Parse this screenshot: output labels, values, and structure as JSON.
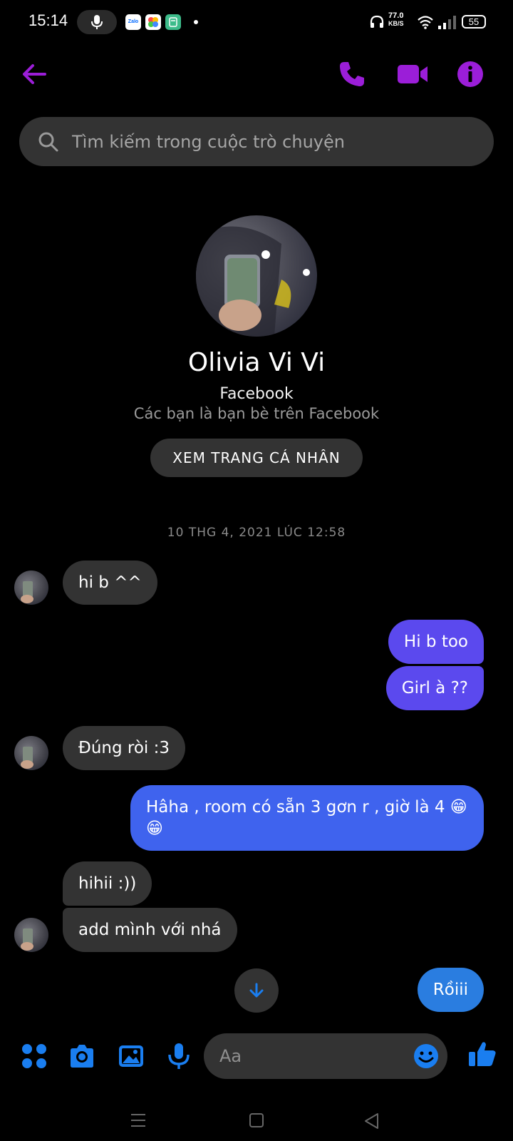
{
  "status_bar": {
    "time": "15:14",
    "apps": [
      "Zalo",
      "",
      ""
    ],
    "speed_value": "77.0",
    "speed_unit": "KB/S",
    "battery": "55"
  },
  "header": {
    "back_icon": "arrow-left-icon",
    "call_icon": "phone-icon",
    "video_icon": "video-camera-icon",
    "info_icon": "info-icon",
    "accent_color": "#9b1ed8"
  },
  "search": {
    "placeholder": "Tìm kiếm trong cuộc trò chuyện"
  },
  "profile": {
    "name": "Olivia Vi Vi",
    "platform": "Facebook",
    "relation": "Các bạn là bạn bè trên Facebook",
    "view_profile_label": "XEM TRANG CÁ NHÂN"
  },
  "conversation": {
    "timestamp": "10 THG 4, 2021 LÚC 12:58",
    "messages": [
      {
        "from": "them",
        "text": "hi b ^^"
      },
      {
        "from": "me",
        "text": "Hi b too"
      },
      {
        "from": "me",
        "text": "Girl à ??"
      },
      {
        "from": "them",
        "text": "Đúng ròi :3"
      },
      {
        "from": "me",
        "text": "Hâha , room có sẵn 3 gơn r , giờ là 4 😁😁"
      },
      {
        "from": "them",
        "text": "hihii :))"
      },
      {
        "from": "them",
        "text": "add mình với nhá"
      },
      {
        "from": "me",
        "text": "Rồiii"
      }
    ]
  },
  "composer": {
    "placeholder": "Aa",
    "tools": [
      "apps-icon",
      "camera-icon",
      "image-icon",
      "microphone-icon"
    ],
    "emoji_icon": "emoji-icon",
    "like_icon": "thumbs-up-icon",
    "accent_color": "#1a7ef0"
  },
  "nav": [
    "recents-icon",
    "home-icon",
    "back-icon"
  ]
}
